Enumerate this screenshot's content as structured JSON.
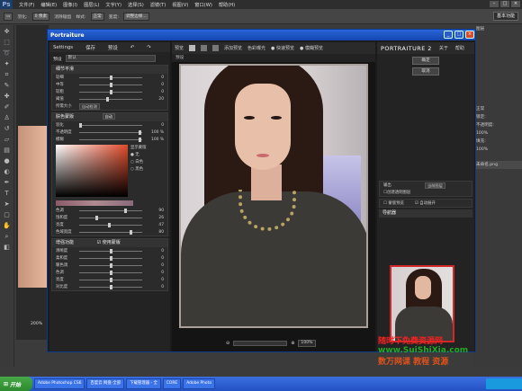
{
  "photoshop": {
    "logo": "Ps",
    "menu": [
      "文件(F)",
      "编辑(E)",
      "图像(I)",
      "图层(L)",
      "文字(Y)",
      "选择(S)",
      "滤镜(T)",
      "视图(V)",
      "窗口(W)",
      "帮助(H)"
    ],
    "options": {
      "feather_label": "羽化:",
      "feather_value": "0 像素",
      "antialias": "消除锯齿",
      "style_label": "样式:",
      "style_value": "正常",
      "width_label": "宽度:",
      "refine_button": "调整边缘..."
    },
    "workspace": "基本功能",
    "zoom": "200%",
    "right_panel": [
      "图层",
      "正常",
      "锁定:",
      "不透明度:",
      "填充:",
      "100%",
      "100%",
      "未命名.png"
    ]
  },
  "plugin": {
    "title": "Portraiture",
    "left": {
      "settings_label": "Settings",
      "save_label": "保存",
      "preset_label": "预设",
      "preset_section": "预设",
      "preset_value": "默认",
      "detail_section": "细节平滑",
      "detail_rows": [
        {
          "label": "较细",
          "value": "0"
        },
        {
          "label": "中等",
          "value": "0"
        },
        {
          "label": "较粗",
          "value": "0"
        },
        {
          "label": "阈值",
          "value": "20"
        }
      ],
      "size_label": "所需大小",
      "size_value": "自动检测",
      "mask_section": "肤色蒙版",
      "mask_mode": "自动",
      "mask_rows": [
        {
          "label": "羽化",
          "value": "0"
        },
        {
          "label": "不透明度",
          "value": "100 %"
        },
        {
          "label": "模糊",
          "value": "100 %"
        }
      ],
      "display_mask_label": "显示蒙版",
      "radios": [
        "无",
        "白色",
        "黑色"
      ],
      "color_rows": [
        {
          "label": "色调",
          "value": "90"
        },
        {
          "label": "饱和度",
          "value": "26"
        },
        {
          "label": "亮度",
          "value": "47"
        },
        {
          "label": "色域宽度",
          "value": "80"
        }
      ],
      "enhance_section": "增强功能",
      "use_mask_label": "使用蒙版",
      "enhance_rows": [
        {
          "label": "清晰度",
          "value": "0"
        },
        {
          "label": "柔和度",
          "value": "0"
        },
        {
          "label": "暖色调",
          "value": "0"
        },
        {
          "label": "色调",
          "value": "0"
        },
        {
          "label": "亮度",
          "value": "0"
        },
        {
          "label": "对比度",
          "value": "0"
        }
      ]
    },
    "preview": {
      "tab": "预览",
      "add_preview": "添加预览",
      "color_exposure": "色彩曝光",
      "fast_preview": "快速预览",
      "blur_preview": "模糊预览",
      "inner_tab": "预设",
      "zoom": "100%"
    },
    "right": {
      "logo": "PORTRAITURE 2",
      "about": "关于",
      "help": "帮助",
      "ok_button": "确定",
      "cancel_button": "取消",
      "output_label": "输出",
      "output_value": "当前图层",
      "create_layer": "创建透明图层",
      "mask_preview": "蒙版预览",
      "auto_expand": "自动展开",
      "navigator": "导航器"
    }
  },
  "taskbar": {
    "start": "开始",
    "tasks": [
      "Adobe Photoshop CS6",
      "百度云 网盘-全部",
      "下载管理器 - 全",
      "CORE",
      "Adobe Photo"
    ]
  },
  "watermark": {
    "line1": "随时下免费资源网",
    "line2": "www.SuiShiXia.com",
    "line3": "数万网课 教程 资源"
  }
}
